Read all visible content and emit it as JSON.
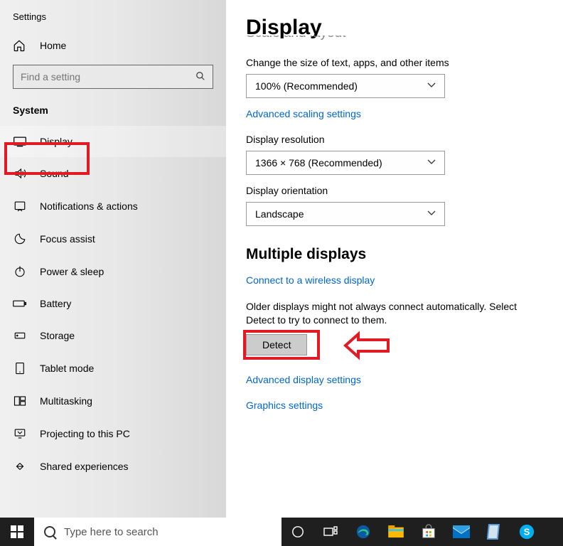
{
  "window_title": "Settings",
  "home_label": "Home",
  "search_placeholder": "Find a setting",
  "category": "System",
  "nav": [
    {
      "label": "Display"
    },
    {
      "label": "Sound"
    },
    {
      "label": "Notifications & actions"
    },
    {
      "label": "Focus assist"
    },
    {
      "label": "Power & sleep"
    },
    {
      "label": "Battery"
    },
    {
      "label": "Storage"
    },
    {
      "label": "Tablet mode"
    },
    {
      "label": "Multitasking"
    },
    {
      "label": "Projecting to this PC"
    },
    {
      "label": "Shared experiences"
    }
  ],
  "content": {
    "heading": "Display",
    "cutoff_section": "Scale and layout",
    "scale_label": "Change the size of text, apps, and other items",
    "scale_value": "100% (Recommended)",
    "adv_scaling_link": "Advanced scaling settings",
    "resolution_label": "Display resolution",
    "resolution_value": "1366 × 768 (Recommended)",
    "orientation_label": "Display orientation",
    "orientation_value": "Landscape",
    "multi_heading": "Multiple displays",
    "wireless_link": "Connect to a wireless display",
    "detect_desc": "Older displays might not always connect automatically. Select Detect to try to connect to them.",
    "detect_btn": "Detect",
    "adv_display_link": "Advanced display settings",
    "graphics_link": "Graphics settings"
  },
  "taskbar": {
    "search_placeholder": "Type here to search"
  }
}
